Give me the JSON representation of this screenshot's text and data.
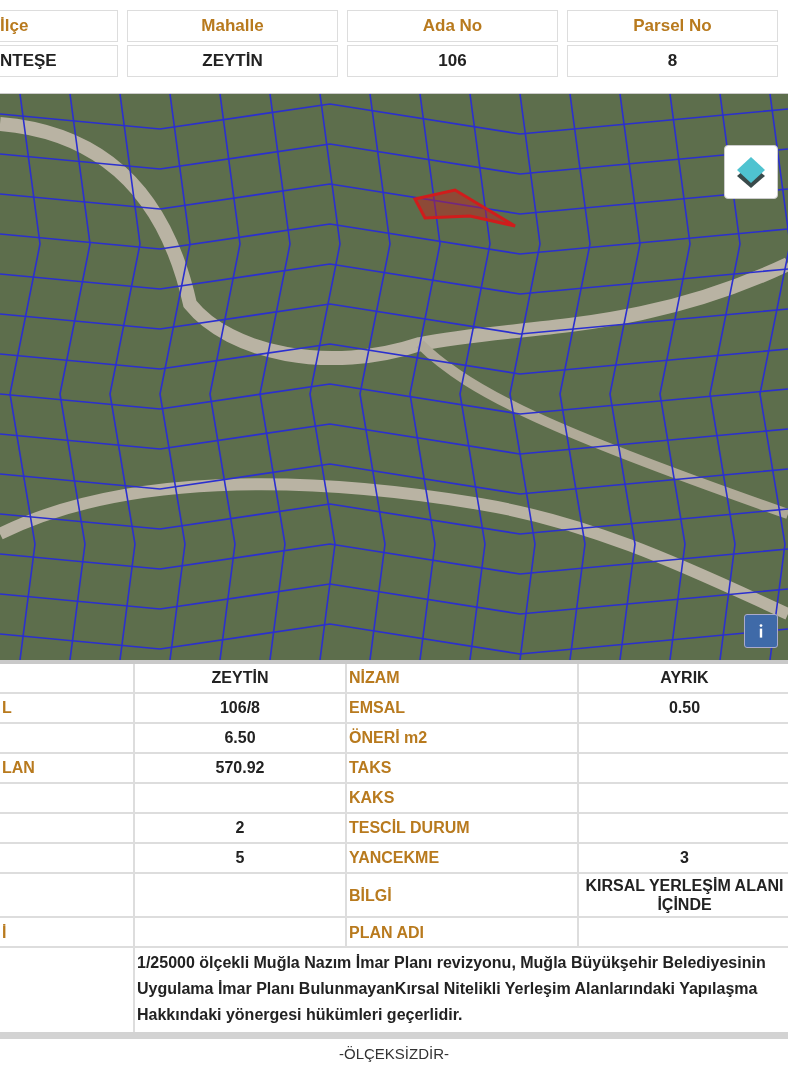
{
  "header": [
    {
      "label": "İlçe",
      "value": "NTEŞE"
    },
    {
      "label": "Mahalle",
      "value": "ZEYTİN"
    },
    {
      "label": "Ada No",
      "value": "106"
    },
    {
      "label": "Parsel No",
      "value": "8"
    }
  ],
  "attributes": [
    {
      "value": "ZEYTİN",
      "label_2": "NİZAM",
      "value_2": "AYRIK"
    },
    {
      "label": "L",
      "value": "106/8",
      "label_2": "EMSAL",
      "value_2": "0.50"
    },
    {
      "value": "6.50",
      "label_2": "ÖNERİ m2"
    },
    {
      "label": "LAN",
      "value": "570.92",
      "label_2": "TAKS"
    },
    {
      "label_2": "KAKS"
    },
    {
      "value": "2",
      "label_2": "TESCİL DURUM"
    },
    {
      "value": "5",
      "label_2": "YANCEKME",
      "value_2": "3"
    },
    {
      "label_2": "BİLGİ",
      "value_2": "KIRSAL YERLEŞİM ALANI İÇİNDE"
    },
    {
      "label": "İ",
      "label_2": "PLAN ADI"
    }
  ],
  "note": "1/25000 ölçekli Muğla Nazım İmar Planı revizyonu, Muğla Büyükşehir Belediyesinin Uygulama İmar Planı BulunmayanKırsal Nitelikli Yerleşim Alanlarındaki Yapılaşma Hakkındaki yönergesi hükümleri geçerlidir.",
  "scale_text": "-ÖLÇEKSİZDİR-"
}
